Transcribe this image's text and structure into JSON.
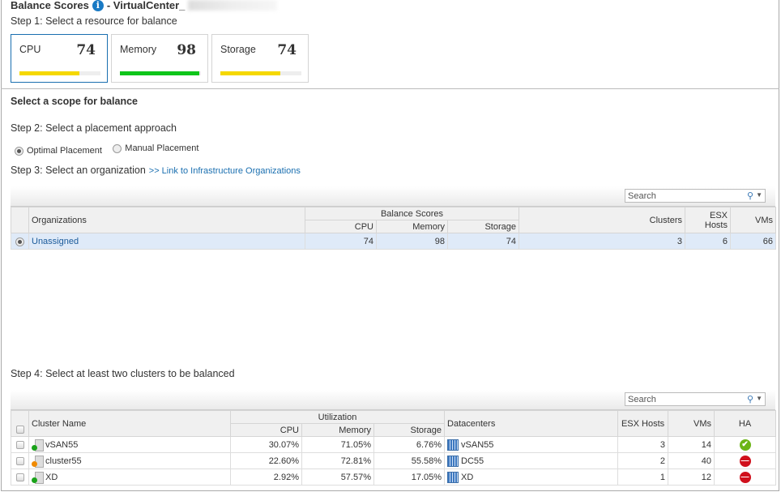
{
  "header": {
    "title": "Balance Scores",
    "vc_label": "- VirtualCenter_"
  },
  "step1": "Step 1: Select a resource for balance",
  "resources": [
    {
      "label": "CPU",
      "score": "74",
      "fill_pct": 74,
      "color": "#f5d800",
      "selected": true
    },
    {
      "label": "Memory",
      "score": "98",
      "fill_pct": 98,
      "color": "#0ec51a",
      "selected": false
    },
    {
      "label": "Storage",
      "score": "74",
      "fill_pct": 74,
      "color": "#f5d800",
      "selected": false
    }
  ],
  "scope_title": "Select a scope for balance",
  "step2": "Step 2: Select a placement approach",
  "placement": {
    "optimal": "Optimal Placement",
    "manual": "Manual Placement",
    "selected": "optimal"
  },
  "step3": "Step 3: Select an organization",
  "org_link": ">> Link to Infrastructure Organizations",
  "search_placeholder": "Search",
  "org_table": {
    "headers": {
      "name": "Organizations",
      "group": "Balance Scores",
      "cpu": "CPU",
      "memory": "Memory",
      "storage": "Storage",
      "clusters": "Clusters",
      "hosts": "ESX Hosts",
      "vms": "VMs"
    },
    "rows": [
      {
        "name": "Unassigned",
        "cpu": "74",
        "memory": "98",
        "storage": "74",
        "clusters": "3",
        "hosts": "6",
        "vms": "66",
        "selected": true
      }
    ]
  },
  "step4": "Step 4: Select at least two clusters to be balanced",
  "cluster_table": {
    "headers": {
      "name": "Cluster Name",
      "group": "Utilization",
      "cpu": "CPU",
      "memory": "Memory",
      "storage": "Storage",
      "datacenters": "Datacenters",
      "hosts": "ESX Hosts",
      "vms": "VMs",
      "ha": "HA"
    },
    "rows": [
      {
        "name": "vSAN55",
        "cpu": "30.07%",
        "memory": "71.05%",
        "storage": "6.76%",
        "datacenter": "vSAN55",
        "hosts": "3",
        "vms": "14",
        "ha": "ok",
        "status": "green"
      },
      {
        "name": "cluster55",
        "cpu": "22.60%",
        "memory": "72.81%",
        "storage": "55.58%",
        "datacenter": "DC55",
        "hosts": "2",
        "vms": "40",
        "ha": "disabled",
        "status": "orange"
      },
      {
        "name": "XD",
        "cpu": "2.92%",
        "memory": "57.57%",
        "storage": "17.05%",
        "datacenter": "XD",
        "hosts": "1",
        "vms": "12",
        "ha": "disabled",
        "status": "green"
      }
    ]
  }
}
